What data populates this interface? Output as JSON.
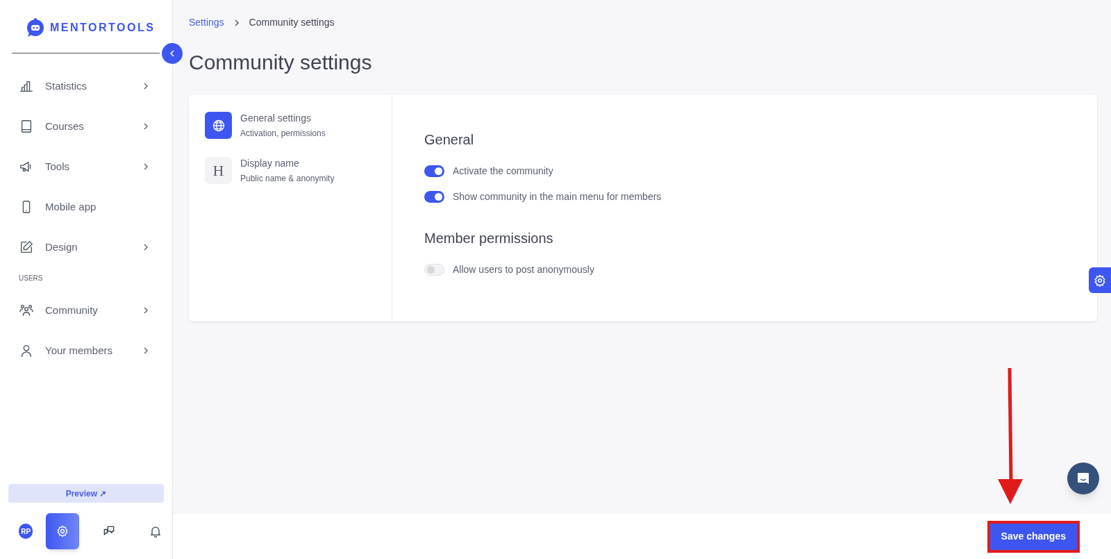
{
  "brand": {
    "name": "MENTORTOOLS"
  },
  "sidebar": {
    "items": [
      {
        "label": "Statistics",
        "has_submenu": true
      },
      {
        "label": "Courses",
        "has_submenu": true
      },
      {
        "label": "Tools",
        "has_submenu": true
      },
      {
        "label": "Mobile app",
        "has_submenu": false
      },
      {
        "label": "Design",
        "has_submenu": true
      }
    ],
    "section_label": "USERS",
    "user_items": [
      {
        "label": "Community",
        "has_submenu": true
      },
      {
        "label": "Your members",
        "has_submenu": true
      }
    ],
    "preview_button": "Preview ↗",
    "avatar": "RP",
    "bottom_tabs": [
      {
        "selected": true
      },
      {
        "selected": false
      },
      {
        "selected": false
      }
    ]
  },
  "breadcrumb": [
    "Settings",
    "Community settings"
  ],
  "page_title": "Community settings",
  "settings_nav": [
    {
      "title": "General settings",
      "subtitle": "Activation, permissions",
      "selected": true
    },
    {
      "title": "Display name",
      "subtitle": "Public name & anonymity",
      "selected": false,
      "glyph": "H"
    }
  ],
  "sections": [
    {
      "title": "General",
      "toggles": [
        {
          "label": "Activate the community",
          "on": true
        },
        {
          "label": "Show community in the main menu for members",
          "on": true
        }
      ]
    },
    {
      "title": "Member permissions",
      "toggles": [
        {
          "label": "Allow users to post anonymously",
          "on": false
        }
      ]
    }
  ],
  "save_button": "Save changes"
}
